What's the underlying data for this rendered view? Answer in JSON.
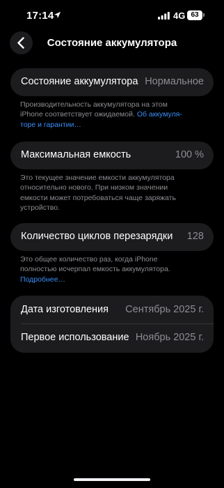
{
  "status_bar": {
    "time": "17:14",
    "network": "4G",
    "battery_level": "63"
  },
  "nav": {
    "title": "Состояние аккумулятора"
  },
  "battery_state": {
    "label": "Состояние аккумулятора",
    "value": "Нормальное",
    "footnote_line1": "Производительность аккумулятора на этом",
    "footnote_line2_text": "iPhone соответствует ожидаемой. ",
    "footnote_line2_link": "Об аккумуля-",
    "footnote_line3_link": "торе и гарантии…"
  },
  "max_capacity": {
    "label": "Максимальная емкость",
    "value": "100 %",
    "footnote_line1": "Это текущее значение емкости аккумулятора",
    "footnote_line2": "относительно нового. При низком значении",
    "footnote_line3": "емкости может потребоваться чаще заряжать",
    "footnote_line4": "устройство."
  },
  "cycle_count": {
    "label": "Количество циклов перезарядки",
    "value": "128",
    "footnote_line1": "Это общее количество раз, когда iPhone",
    "footnote_line2": "полностью исчерпал емкость аккумулятора.",
    "footnote_link": "Подробнее…"
  },
  "dates": {
    "manufacture_label": "Дата изготовления",
    "manufacture_value": "Сентябрь 2025 г.",
    "first_use_label": "Первое использование",
    "first_use_value": "Ноябрь 2025 г."
  },
  "colors": {
    "background": "#000000",
    "cell_background": "#1c1c1e",
    "secondary_text": "#8d8d93",
    "link": "#3a8ff7"
  }
}
